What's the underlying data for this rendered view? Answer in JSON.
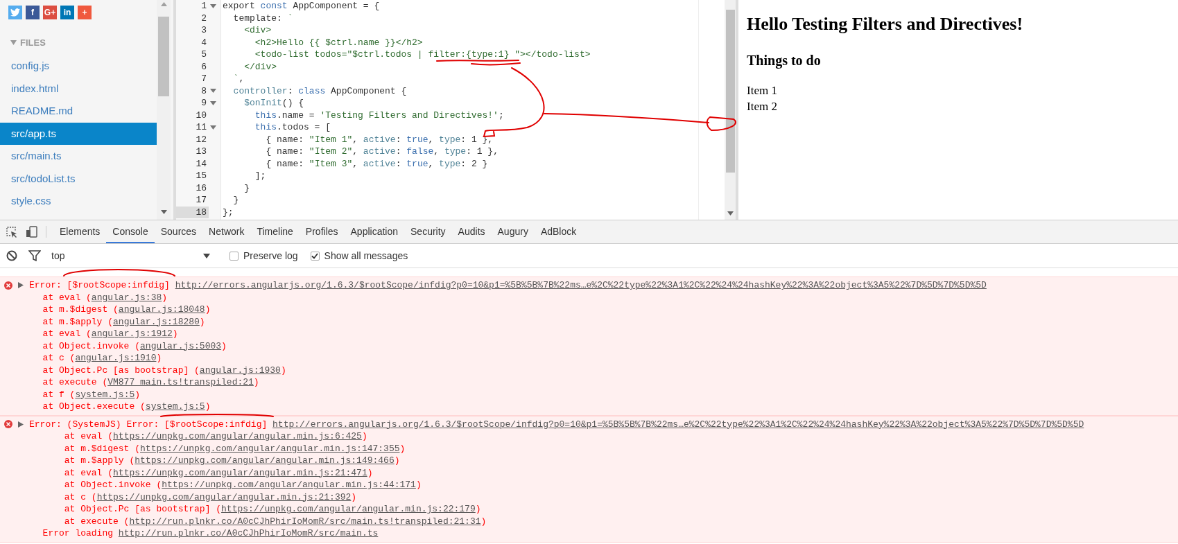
{
  "sidebar": {
    "share_buttons": [
      {
        "kind": "twitter",
        "color": "#55acee"
      },
      {
        "kind": "letter",
        "label": "f",
        "color": "#3b5998"
      },
      {
        "kind": "letter",
        "label": "G+",
        "color": "#dc4e41"
      },
      {
        "kind": "letter",
        "label": "in",
        "color": "#0077b5"
      },
      {
        "kind": "letter",
        "label": "+",
        "color": "#f0593e"
      }
    ],
    "files_heading": "FILES",
    "files": [
      {
        "name": "config.js",
        "selected": false
      },
      {
        "name": "index.html",
        "selected": false
      },
      {
        "name": "README.md",
        "selected": false
      },
      {
        "name": "src/app.ts",
        "selected": true
      },
      {
        "name": "src/main.ts",
        "selected": false
      },
      {
        "name": "src/todoList.ts",
        "selected": false
      },
      {
        "name": "style.css",
        "selected": false
      }
    ]
  },
  "editor": {
    "lines": [
      {
        "number": "1",
        "foldable": true,
        "active": false,
        "tokens": [
          {
            "kind": "plain",
            "text": "export "
          },
          {
            "kind": "kw",
            "text": "const"
          },
          {
            "kind": "plain",
            "text": " AppComponent = {"
          }
        ]
      },
      {
        "number": "2",
        "foldable": false,
        "active": false,
        "tokens": [
          {
            "kind": "plain",
            "text": "  template: "
          },
          {
            "kind": "str",
            "text": "`"
          }
        ]
      },
      {
        "number": "3",
        "foldable": false,
        "active": false,
        "tokens": [
          {
            "kind": "str",
            "text": "    <div>"
          }
        ]
      },
      {
        "number": "4",
        "foldable": false,
        "active": false,
        "tokens": [
          {
            "kind": "str",
            "text": "      <h2>Hello {{ $ctrl.name }}</h2>"
          }
        ]
      },
      {
        "number": "5",
        "foldable": false,
        "active": false,
        "tokens": [
          {
            "kind": "str",
            "text": "      <todo-list todos=\"$ctrl.todos | filter:{type:1} \"></todo-list>"
          }
        ]
      },
      {
        "number": "6",
        "foldable": false,
        "active": false,
        "tokens": [
          {
            "kind": "str",
            "text": "    </div>"
          }
        ]
      },
      {
        "number": "7",
        "foldable": false,
        "active": false,
        "tokens": [
          {
            "kind": "str",
            "text": "  `"
          },
          {
            "kind": "plain",
            "text": ","
          }
        ]
      },
      {
        "number": "8",
        "foldable": true,
        "active": false,
        "tokens": [
          {
            "kind": "prop",
            "text": "  controller"
          },
          {
            "kind": "plain",
            "text": ": "
          },
          {
            "kind": "kw",
            "text": "class"
          },
          {
            "kind": "plain",
            "text": " AppComponent {"
          }
        ]
      },
      {
        "number": "9",
        "foldable": true,
        "active": false,
        "tokens": [
          {
            "kind": "prop",
            "text": "    $onInit"
          },
          {
            "kind": "plain",
            "text": "() {"
          }
        ]
      },
      {
        "number": "10",
        "foldable": false,
        "active": false,
        "tokens": [
          {
            "kind": "kw",
            "text": "      this"
          },
          {
            "kind": "plain",
            "text": ".name = "
          },
          {
            "kind": "str",
            "text": "'Testing Filters and Directives!'"
          },
          {
            "kind": "plain",
            "text": ";"
          }
        ]
      },
      {
        "number": "11",
        "foldable": true,
        "active": false,
        "tokens": [
          {
            "kind": "kw",
            "text": "      this"
          },
          {
            "kind": "plain",
            "text": ".todos = ["
          }
        ]
      },
      {
        "number": "12",
        "foldable": false,
        "active": false,
        "tokens": [
          {
            "kind": "plain",
            "text": "        { name: "
          },
          {
            "kind": "str",
            "text": "\"Item 1\""
          },
          {
            "kind": "plain",
            "text": ", "
          },
          {
            "kind": "prop",
            "text": "active"
          },
          {
            "kind": "plain",
            "text": ": "
          },
          {
            "kind": "kw",
            "text": "true"
          },
          {
            "kind": "plain",
            "text": ", "
          },
          {
            "kind": "prop",
            "text": "type"
          },
          {
            "kind": "plain",
            "text": ": 1 },"
          }
        ]
      },
      {
        "number": "13",
        "foldable": false,
        "active": false,
        "tokens": [
          {
            "kind": "plain",
            "text": "        { name: "
          },
          {
            "kind": "str",
            "text": "\"Item 2\""
          },
          {
            "kind": "plain",
            "text": ", "
          },
          {
            "kind": "prop",
            "text": "active"
          },
          {
            "kind": "plain",
            "text": ": "
          },
          {
            "kind": "kw",
            "text": "false"
          },
          {
            "kind": "plain",
            "text": ", "
          },
          {
            "kind": "prop",
            "text": "type"
          },
          {
            "kind": "plain",
            "text": ": 1 },"
          }
        ]
      },
      {
        "number": "14",
        "foldable": false,
        "active": false,
        "tokens": [
          {
            "kind": "plain",
            "text": "        { name: "
          },
          {
            "kind": "str",
            "text": "\"Item 3\""
          },
          {
            "kind": "plain",
            "text": ", "
          },
          {
            "kind": "prop",
            "text": "active"
          },
          {
            "kind": "plain",
            "text": ": "
          },
          {
            "kind": "kw",
            "text": "true"
          },
          {
            "kind": "plain",
            "text": ", "
          },
          {
            "kind": "prop",
            "text": "type"
          },
          {
            "kind": "plain",
            "text": ": 2 }"
          }
        ]
      },
      {
        "number": "15",
        "foldable": false,
        "active": false,
        "tokens": [
          {
            "kind": "plain",
            "text": "      ];"
          }
        ]
      },
      {
        "number": "16",
        "foldable": false,
        "active": false,
        "tokens": [
          {
            "kind": "plain",
            "text": "    }"
          }
        ]
      },
      {
        "number": "17",
        "foldable": false,
        "active": false,
        "tokens": [
          {
            "kind": "plain",
            "text": "  }"
          }
        ]
      },
      {
        "number": "18",
        "foldable": false,
        "active": true,
        "tokens": [
          {
            "kind": "plain",
            "text": "};"
          }
        ]
      }
    ]
  },
  "preview": {
    "heading": "Hello Testing Filters and Directives!",
    "subheading": "Things to do",
    "items": [
      "Item 1",
      "Item 2"
    ]
  },
  "devtools": {
    "tabs": [
      {
        "label": "Elements",
        "selected": false
      },
      {
        "label": "Console",
        "selected": true
      },
      {
        "label": "Sources",
        "selected": false
      },
      {
        "label": "Network",
        "selected": false
      },
      {
        "label": "Timeline",
        "selected": false
      },
      {
        "label": "Profiles",
        "selected": false
      },
      {
        "label": "Application",
        "selected": false
      },
      {
        "label": "Security",
        "selected": false
      },
      {
        "label": "Audits",
        "selected": false
      },
      {
        "label": "Augury",
        "selected": false
      },
      {
        "label": "AdBlock",
        "selected": false
      }
    ],
    "context": "top",
    "options": [
      {
        "label": "Preserve log",
        "checked": false
      },
      {
        "label": "Show all messages",
        "checked": true
      }
    ],
    "messages": [
      {
        "expanded": false,
        "text": "Error: [$rootScope:infdig]",
        "link": "http://errors.angularjs.org/1.6.3/$rootScope/infdig?p0=10&p1=%5B%5B%7B%22ms…e%2C%22type%22%3A1%2C%22%24%24hashKey%22%3A%22object%3A5%22%7D%5D%7D%5D%5D",
        "stack": [
          {
            "text": "  at eval (",
            "link": "angular.js:38",
            "suffix": ")"
          },
          {
            "text": "  at m.$digest (",
            "link": "angular.js:18048",
            "suffix": ")"
          },
          {
            "text": "  at m.$apply (",
            "link": "angular.js:18280",
            "suffix": ")"
          },
          {
            "text": "  at eval (",
            "link": "angular.js:1912",
            "suffix": ")"
          },
          {
            "text": "  at Object.invoke (",
            "link": "angular.js:5003",
            "suffix": ")"
          },
          {
            "text": "  at c (",
            "link": "angular.js:1910",
            "suffix": ")"
          },
          {
            "text": "  at Object.Pc [as bootstrap] (",
            "link": "angular.js:1930",
            "suffix": ")"
          },
          {
            "text": "  at execute (",
            "link": "VM877 main.ts!transpiled:21",
            "suffix": ")"
          },
          {
            "text": "  at f (",
            "link": "system.js:5",
            "suffix": ")"
          },
          {
            "text": "  at Object.execute (",
            "link": "system.js:5",
            "suffix": ")"
          }
        ]
      },
      {
        "expanded": false,
        "text": "Error: (SystemJS) Error: [$rootScope:infdig]",
        "link": "http://errors.angularjs.org/1.6.3/$rootScope/infdig?p0=10&p1=%5B%5B%7B%22ms…e%2C%22type%22%3A1%2C%22%24%24hashKey%22%3A%22object%3A5%22%7D%5D%7D%5D%5D",
        "stack": [
          {
            "text": "      at eval (",
            "link": "https://unpkg.com/angular/angular.min.js:6:425",
            "suffix": ")"
          },
          {
            "text": "      at m.$digest (",
            "link": "https://unpkg.com/angular/angular.min.js:147:355",
            "suffix": ")"
          },
          {
            "text": "      at m.$apply (",
            "link": "https://unpkg.com/angular/angular.min.js:149:466",
            "suffix": ")"
          },
          {
            "text": "      at eval (",
            "link": "https://unpkg.com/angular/angular.min.js:21:471",
            "suffix": ")"
          },
          {
            "text": "      at Object.invoke (",
            "link": "https://unpkg.com/angular/angular.min.js:44:171",
            "suffix": ")"
          },
          {
            "text": "      at c (",
            "link": "https://unpkg.com/angular/angular.min.js:21:392",
            "suffix": ")"
          },
          {
            "text": "      at Object.Pc [as bootstrap] (",
            "link": "https://unpkg.com/angular/angular.min.js:22:179",
            "suffix": ")"
          },
          {
            "text": "      at execute (",
            "link": "http://run.plnkr.co/A0cCJhPhirIoMomR/src/main.ts!transpiled:21:31",
            "suffix": ")"
          },
          {
            "text": "  Error loading ",
            "link": "http://run.plnkr.co/A0cCJhPhirIoMomR/src/main.ts"
          }
        ]
      }
    ]
  }
}
